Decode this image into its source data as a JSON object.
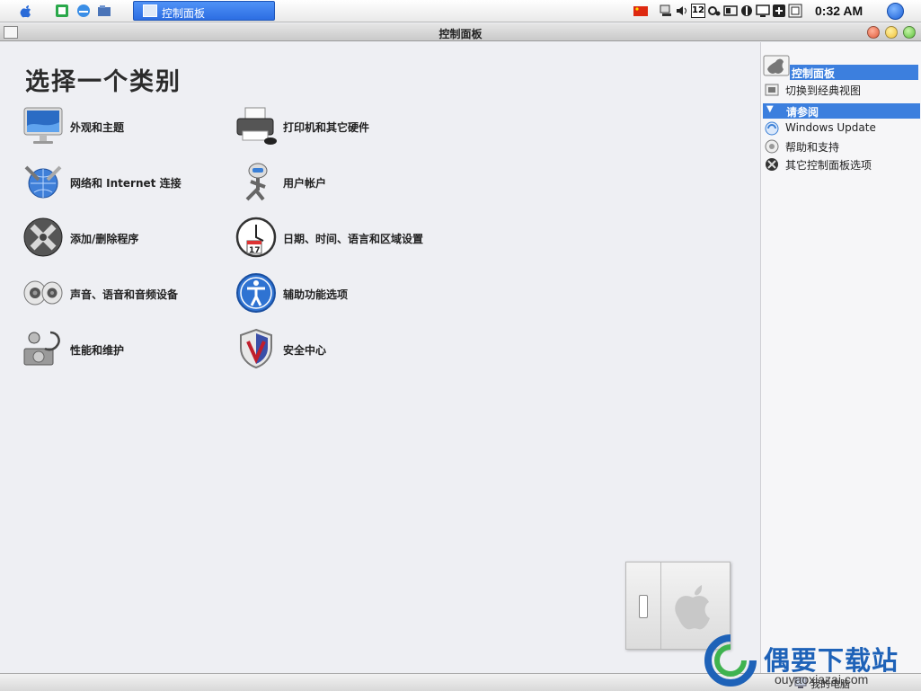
{
  "taskbar": {
    "active_window": "控制面板",
    "clock": "0:32 AM",
    "tray_number": "12"
  },
  "window": {
    "title": "控制面板"
  },
  "main": {
    "heading": "选择一个类别",
    "categories": [
      {
        "label": "外观和主题",
        "icon": "monitor-icon"
      },
      {
        "label": "打印机和其它硬件",
        "icon": "printer-icon"
      },
      {
        "label": "网络和 Internet 连接",
        "icon": "network-globe-icon"
      },
      {
        "label": "用户帐户",
        "icon": "user-robot-icon"
      },
      {
        "label": "添加/删除程序",
        "icon": "add-remove-programs-icon"
      },
      {
        "label": "日期、时间、语言和区域设置",
        "icon": "clock-calendar-icon"
      },
      {
        "label": "声音、语音和音频设备",
        "icon": "speakers-icon"
      },
      {
        "label": "辅助功能选项",
        "icon": "accessibility-icon"
      },
      {
        "label": "性能和维护",
        "icon": "stethoscope-drive-icon"
      },
      {
        "label": "安全中心",
        "icon": "security-shield-icon"
      }
    ]
  },
  "pane": {
    "control_panel_header": "控制面板",
    "switch_classic": "切换到经典视图",
    "see_also_header": "请参阅",
    "see_also": [
      {
        "label": "Windows Update",
        "icon": "windows-update-icon"
      },
      {
        "label": "帮助和支持",
        "icon": "help-support-icon"
      },
      {
        "label": "其它控制面板选项",
        "icon": "other-options-icon"
      }
    ]
  },
  "statusbar": {
    "computer": "我的电脑"
  },
  "watermark": {
    "title": "偶要下载站",
    "url": "ouyaoxiazai.com"
  },
  "colors": {
    "accent": "#3c7fde",
    "window_close": "#e05a3a",
    "window_minimize": "#f2c23a",
    "window_maximize": "#5bbf3a"
  }
}
